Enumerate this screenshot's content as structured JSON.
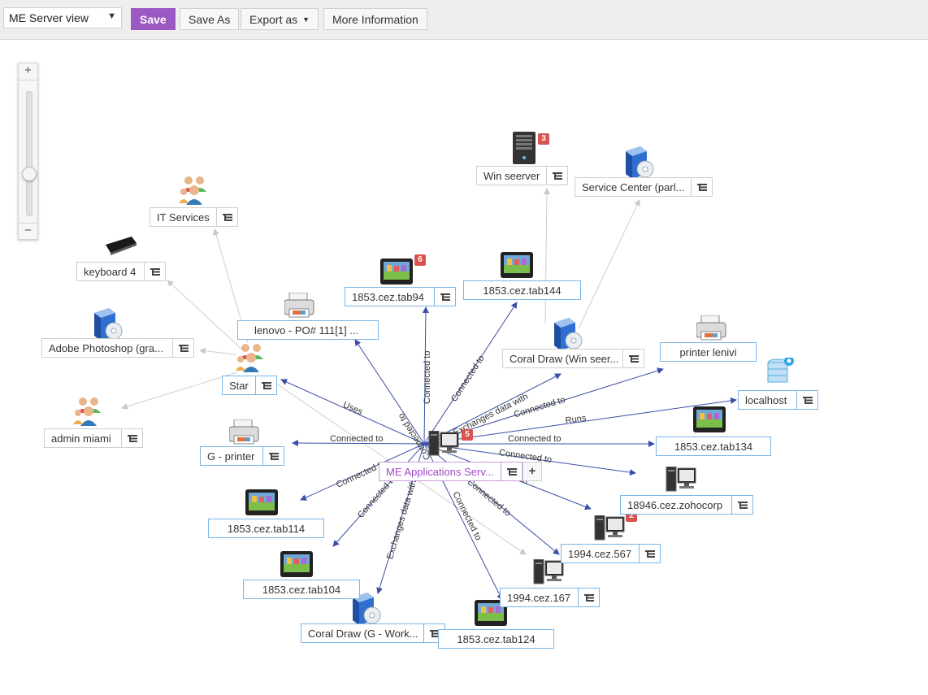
{
  "toolbar": {
    "view_select": "ME Server view",
    "save": "Save",
    "save_as": "Save As",
    "export_as": "Export as",
    "more_info": "More Information"
  },
  "zoom": {
    "plus": "+",
    "minus": "−"
  },
  "center": {
    "label": "ME Applications Serv...",
    "badge": "5",
    "expand": "+"
  },
  "nodes": {
    "win_seerver": "Win seerver",
    "service_center": "Service Center (parl...",
    "it_services": "IT Services",
    "keyboard4": "keyboard 4",
    "tab94": "1853.cez.tab94",
    "tab144": "1853.cez.tab144",
    "lenovo": "lenovo - PO# 111[1] ...",
    "adobe": "Adobe Photoshop (gra...",
    "coral_win": "Coral Draw (Win seer...",
    "printer_lenivi": "printer lenivi",
    "star": "Star",
    "localhost": "localhost",
    "admin_miami": "admin miami",
    "tab134": "1853.cez.tab134",
    "g_printer": "G - printer",
    "zohocorp": "18946.cez.zohocorp",
    "tab114": "1853.cez.tab114",
    "c567": "1994.cez.567",
    "c167": "1994.cez.167",
    "tab104": "1853.cez.tab104",
    "coral_g": "Coral Draw (G - Work...",
    "tab124": "1853.cez.tab124"
  },
  "badges": {
    "win_seerver": "3",
    "tab94": "6",
    "c567": "2"
  },
  "edges": {
    "connected_to": "Connected to",
    "exchanges_data_with": "Exchanges data with",
    "uses": "Uses",
    "runs": "Runs",
    "depends_on": "Depends on"
  },
  "colors": {
    "accent": "#9b59c4",
    "link_strong": "#3a4fa8",
    "link_faint": "#c8c8c8",
    "badge": "#d9534f",
    "selected_border": "#7ab5e6"
  },
  "icons": {
    "server": "server-tower-icon",
    "software": "software-box-icon",
    "users": "user-group-icon",
    "keyboard": "keyboard-icon",
    "tablet": "tablet-icon",
    "printer": "printer-icon",
    "workstation": "desktop-computer-icon",
    "database": "database-gear-icon"
  }
}
